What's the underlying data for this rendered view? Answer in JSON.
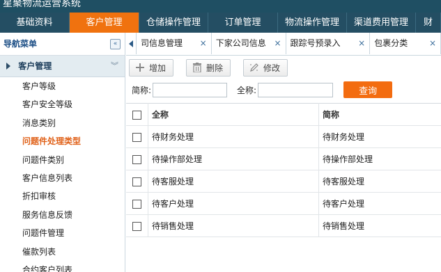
{
  "window": {
    "title": "星聚物流运营系统"
  },
  "topnav": [
    {
      "label": "基础资料",
      "width": 100,
      "active": false
    },
    {
      "label": "客户管理",
      "width": 100,
      "active": true
    },
    {
      "label": "仓储操作管理",
      "width": 99,
      "active": false
    },
    {
      "label": "订单管理",
      "width": 100,
      "active": false
    },
    {
      "label": "物流操作管理",
      "width": 99,
      "active": false
    },
    {
      "label": "渠道费用管理",
      "width": 99,
      "active": false
    },
    {
      "label": "财",
      "width": 36,
      "active": false
    }
  ],
  "sidebar": {
    "header": "导航菜单",
    "collapse_icon": "«",
    "group": "客户管理",
    "group_chevron": "︾",
    "items": [
      {
        "label": "客户等级",
        "active": false
      },
      {
        "label": "客户安全等级",
        "active": false
      },
      {
        "label": "消息类别",
        "active": false
      },
      {
        "label": "问题件处理类型",
        "active": true
      },
      {
        "label": "问题件类别",
        "active": false
      },
      {
        "label": "客户信息列表",
        "active": false
      },
      {
        "label": "折扣审核",
        "active": false
      },
      {
        "label": "服务信息反馈",
        "active": false
      },
      {
        "label": "问题件管理",
        "active": false
      },
      {
        "label": "催款列表",
        "active": false
      },
      {
        "label": "合约客户列表",
        "active": false
      }
    ]
  },
  "tabs": [
    {
      "label": "司信息管理",
      "width": 108
    },
    {
      "label": "下家公司信息",
      "width": 107
    },
    {
      "label": "跟踪号预录入",
      "width": 121
    },
    {
      "label": "包裹分类",
      "width": 102
    }
  ],
  "toolbar": {
    "add": "增加",
    "delete": "删除",
    "edit": "修改"
  },
  "search": {
    "short_label": "简称:",
    "short_value": "",
    "full_label": "全称:",
    "full_value": "",
    "query": "查询"
  },
  "table": {
    "headers": [
      "全称",
      "简称"
    ],
    "rows": [
      [
        "待财务处理",
        "待财务处理"
      ],
      [
        "待操作部处理",
        "待操作部处理"
      ],
      [
        "待客服处理",
        "待客服处理"
      ],
      [
        "待客户处理",
        "待客户处理"
      ],
      [
        "待销售处理",
        "待销售处理"
      ]
    ]
  },
  "colors": {
    "nav_bg": "#244e63",
    "accent": "#f0720f",
    "active_item": "#e0621a"
  }
}
